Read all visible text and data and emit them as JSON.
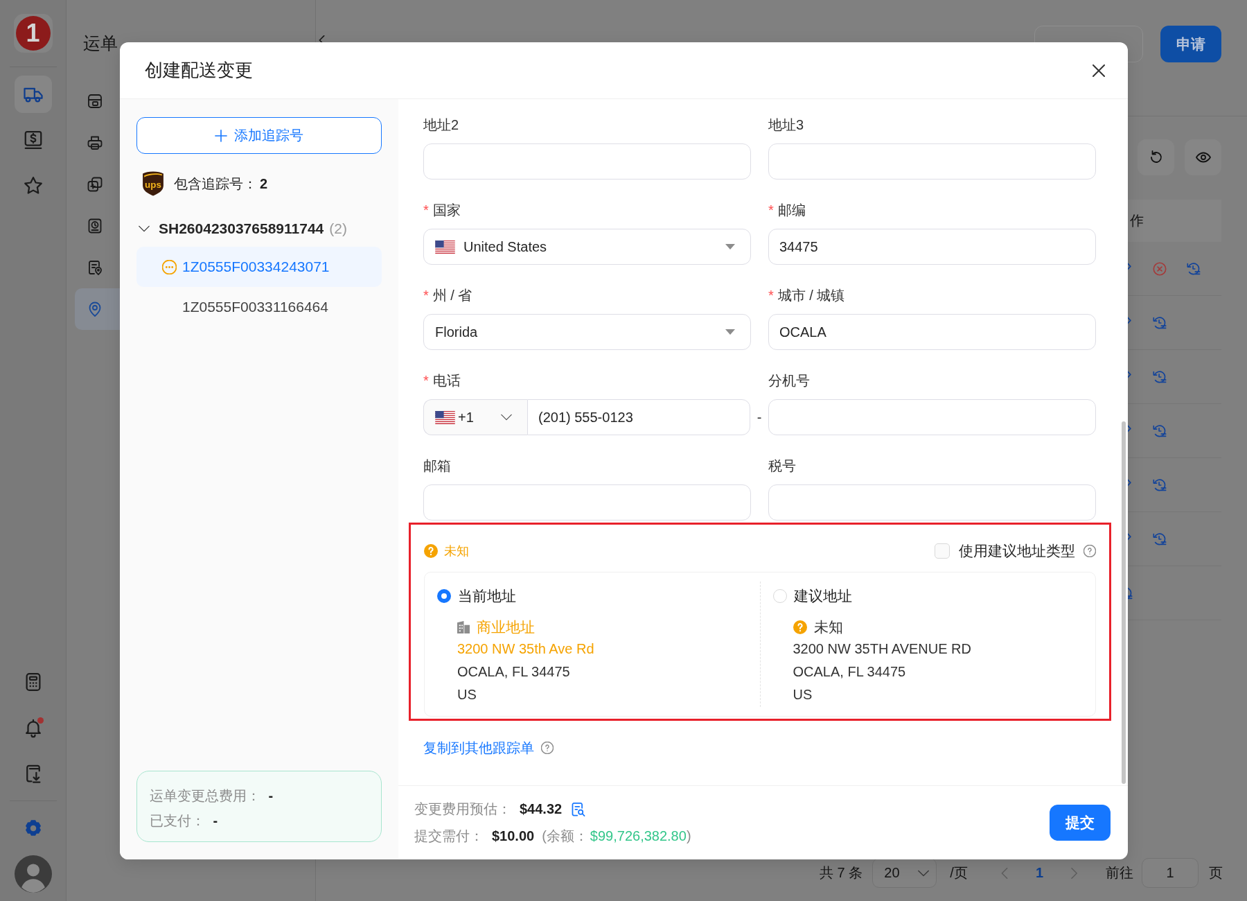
{
  "rail": {
    "logo": "1",
    "top_items": [
      {
        "selected": true
      },
      {
        "selected": false
      },
      {
        "selected": false
      }
    ],
    "bottom_items": [
      {
        "unread": false
      },
      {
        "unread": true
      },
      {
        "unread": false
      }
    ]
  },
  "sidebar": {
    "title": "运单",
    "items": [
      {
        "selected": false
      },
      {
        "selected": false
      },
      {
        "selected": false
      },
      {
        "selected": false
      },
      {
        "selected": false
      },
      {
        "selected": true
      }
    ]
  },
  "toolbar": {
    "apply_button": "申请"
  },
  "table": {
    "columns": [
      "作"
    ],
    "rows": [
      {
        "editable": true,
        "cancelable": true
      },
      {
        "editable": true,
        "cancelable": false
      },
      {
        "editable": true,
        "cancelable": false
      },
      {
        "editable": true,
        "cancelable": false
      },
      {
        "editable": true,
        "cancelable": false
      },
      {
        "editable": true,
        "cancelable": false
      },
      {
        "editable": false,
        "cancelable": false
      }
    ]
  },
  "pagination": {
    "total": "共 7 条",
    "page_size": "20",
    "per_page": "/页",
    "prev_disabled": true,
    "pages": [
      {
        "label": "1",
        "selected": true
      }
    ],
    "next_disabled": true,
    "goto_label": "前往",
    "goto_value": "1",
    "goto_suffix": "页"
  },
  "modal": {
    "title": "创建配送变更",
    "add_button": "添加追踪号",
    "carrier": {
      "logo": "ups",
      "label": "包含追踪号：",
      "count": "2"
    },
    "shipments": [
      {
        "id": "SH260423037658911744",
        "count": "(2)",
        "expanded": true,
        "children": [
          {
            "tracking": "1Z0555F00334243071",
            "selected": true,
            "pending": true
          },
          {
            "tracking": "1Z0555F00331166464",
            "selected": false,
            "pending": false
          }
        ]
      }
    ],
    "cost_summary": [
      "运单变更总费用： **-**",
      "已支付： **-**"
    ],
    "form": {
      "fields": [
        {
          "label": "地址2",
          "kind": "text"
        },
        {
          "label": "地址3",
          "kind": "text"
        },
        {
          "label": "国家",
          "required_mark": "*",
          "kind": "country",
          "value": "United States"
        },
        {
          "label": "邮编",
          "required_mark": "*",
          "kind": "text",
          "value": "34475"
        },
        {
          "label": "州 / 省",
          "required_mark": "*",
          "kind": "select",
          "value": "Florida"
        },
        {
          "label": "城市 / 城镇",
          "required_mark": "*",
          "kind": "text",
          "value": "OCALA"
        },
        {
          "label": "电话",
          "required_mark": "*",
          "kind": "phone",
          "dial_code": "+1",
          "value": "(201) 555-0123",
          "separator": "-"
        },
        {
          "label": "分机号",
          "kind": "text"
        },
        {
          "label": "邮箱",
          "kind": "text"
        },
        {
          "label": "税号",
          "kind": "text"
        }
      ]
    },
    "address_check": {
      "annotated": true,
      "status": {
        "kind": "unknown",
        "label": "未知"
      },
      "use_suggested_type": {
        "label": "使用建议地址类型",
        "checked": false
      },
      "options": [
        {
          "title": "当前地址",
          "selected": true,
          "type": {
            "kind": "business",
            "label": "商业地址",
            "highlighted": true
          },
          "lines": [
            {
              "text": "3200 NW 35th Ave Rd",
              "highlighted": true
            },
            {
              "text": "OCALA, FL 34475",
              "highlighted": false
            },
            {
              "text": "US",
              "highlighted": false
            }
          ]
        },
        {
          "title": "建议地址",
          "selected": false,
          "type": {
            "kind": "unknown",
            "label": "未知",
            "highlighted": false
          },
          "lines": [
            {
              "text": "3200 NW 35TH AVENUE RD",
              "highlighted": false
            },
            {
              "text": "OCALA, FL 34475",
              "highlighted": false
            },
            {
              "text": "US",
              "highlighted": false
            }
          ]
        }
      ]
    },
    "copy_link": "复制到其他跟踪单",
    "estimate": {
      "label": "变更费用预估：",
      "value": "$44.32"
    },
    "payment": {
      "label": "提交需付：",
      "value": "$10.00",
      "balance_open": "(余额：",
      "balance": "$99,726,382.80",
      "balance_close": ")"
    },
    "submit_button": "提交"
  }
}
